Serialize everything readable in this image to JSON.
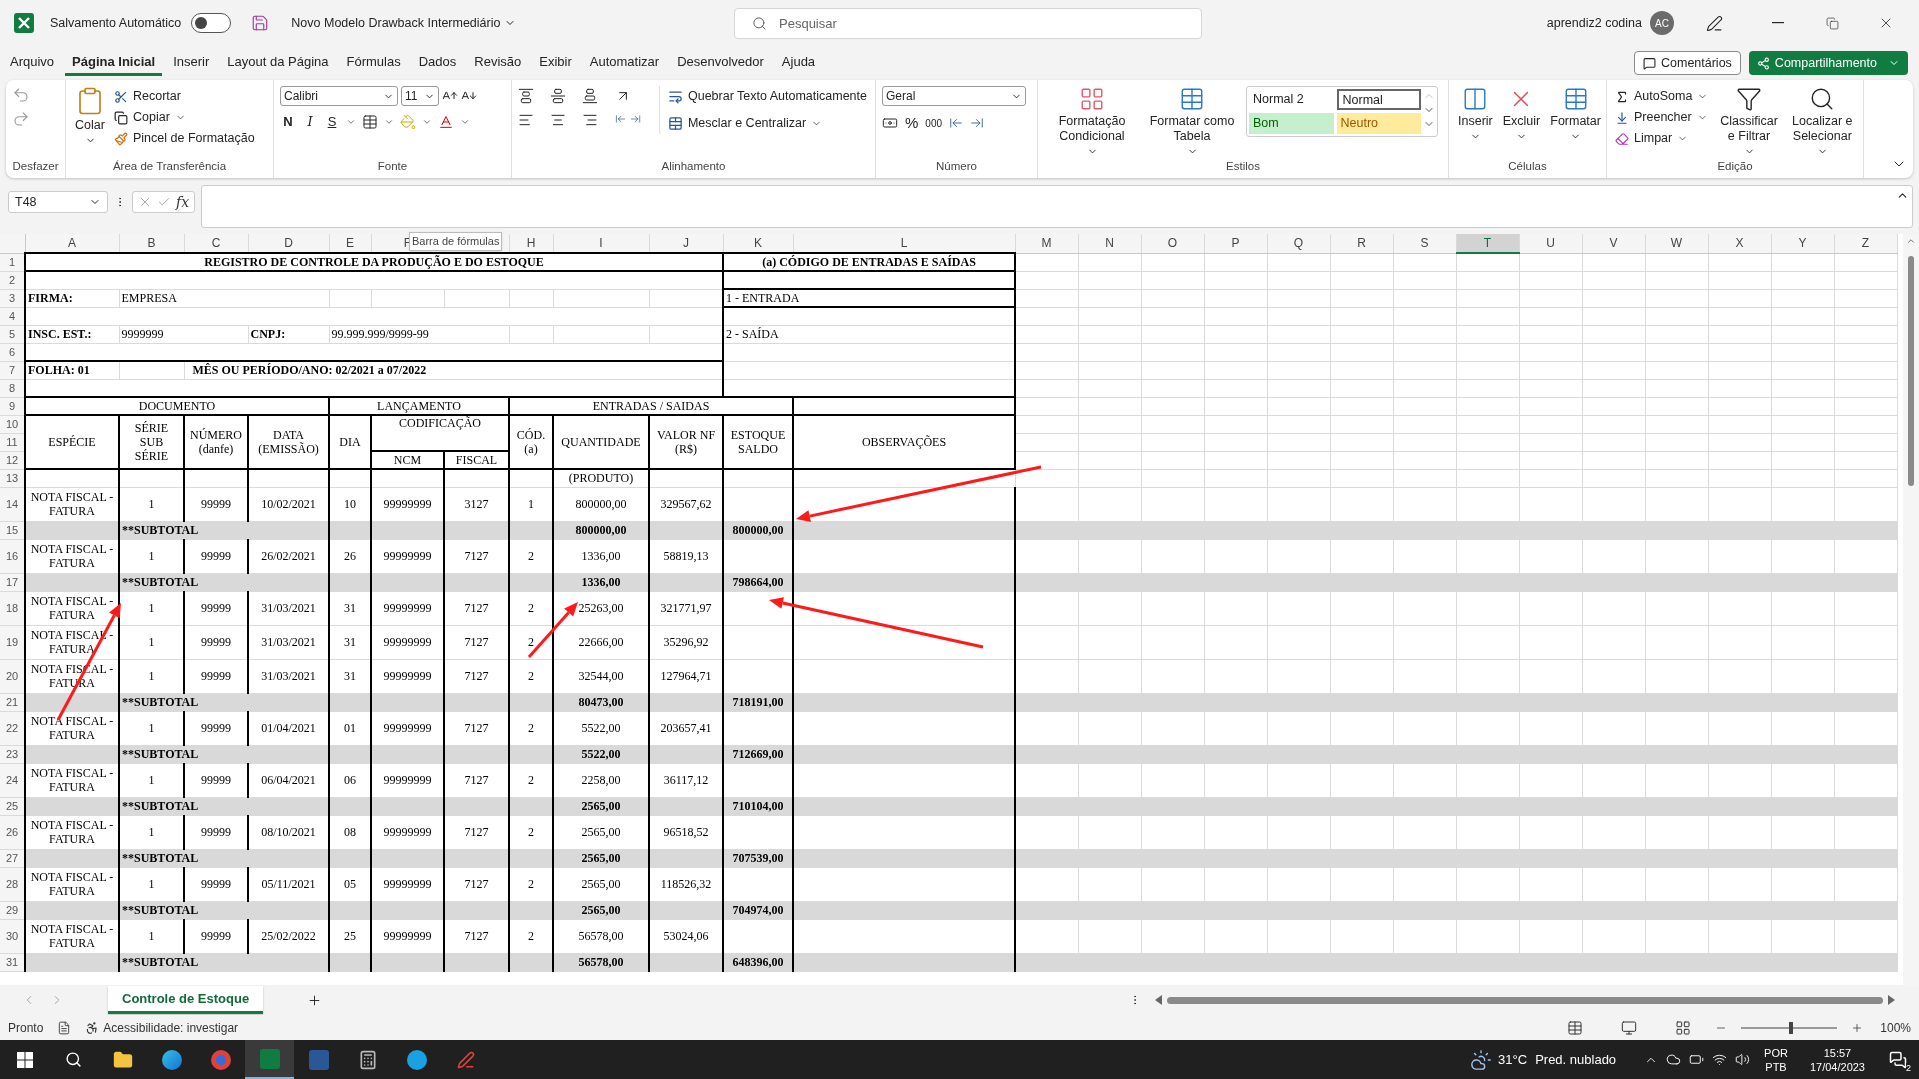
{
  "title_bar": {
    "autosave_label": "Salvamento Automático",
    "autosave_on": false,
    "file_name": "Novo Modelo Drawback Intermediário",
    "search_placeholder": "Pesquisar",
    "user_name": "aprendiz2 codina",
    "user_initials": "AC"
  },
  "menu_tabs": [
    {
      "label": "Arquivo",
      "selected": false
    },
    {
      "label": "Página Inicial",
      "selected": true
    },
    {
      "label": "Inserir",
      "selected": false
    },
    {
      "label": "Layout da Página",
      "selected": false
    },
    {
      "label": "Fórmulas",
      "selected": false
    },
    {
      "label": "Dados",
      "selected": false
    },
    {
      "label": "Revisão",
      "selected": false
    },
    {
      "label": "Exibir",
      "selected": false
    },
    {
      "label": "Automatizar",
      "selected": false
    },
    {
      "label": "Desenvolvedor",
      "selected": false
    },
    {
      "label": "Ajuda",
      "selected": false
    }
  ],
  "action_buttons": {
    "comments": "Comentários",
    "share": "Compartilhamento"
  },
  "ribbon": {
    "undo": {
      "label": "Desfazer"
    },
    "clipboard": {
      "label": "Área de Transferência",
      "paste": "Colar",
      "cut": "Recortar",
      "copy": "Copiar",
      "format_painter": "Pincel de Formatação"
    },
    "font": {
      "label": "Fonte",
      "family": "Calibri",
      "size": "11",
      "bold": "N",
      "italic": "I",
      "underline": "S"
    },
    "alignment": {
      "label": "Alinhamento",
      "wrap": "Quebrar Texto Automaticamente",
      "merge": "Mesclar e Centralizar"
    },
    "number": {
      "label": "Número",
      "format": "Geral",
      "percent": "%",
      "thousands": "000"
    },
    "styles": {
      "label": "Estilos",
      "conditional": "Formatação Condicional",
      "table": "Formatar como Tabela",
      "gallery": [
        {
          "label": "Normal 2",
          "kind": "plain"
        },
        {
          "label": "Normal",
          "kind": "outlined"
        },
        {
          "label": "Bom",
          "kind": "good"
        },
        {
          "label": "Neutro",
          "kind": "neutral"
        }
      ]
    },
    "cells": {
      "label": "Células",
      "insert": "Inserir",
      "delete": "Excluir",
      "format": "Formatar"
    },
    "editing": {
      "label": "Edição",
      "autosum": "AutoSoma",
      "fill": "Preencher",
      "clear": "Limpar",
      "sort": "Classificar e Filtrar",
      "find": "Localizar e Selecionar"
    }
  },
  "formula_bar": {
    "name_box": "T48",
    "function_symbol": "fx",
    "tooltip": "Barra de fórmulas"
  },
  "columns": [
    {
      "label": "A",
      "selected": false
    },
    {
      "label": "B",
      "selected": false
    },
    {
      "label": "C",
      "selected": false
    },
    {
      "label": "D",
      "selected": false
    },
    {
      "label": "E",
      "selected": false
    },
    {
      "label": "F",
      "selected": false
    },
    {
      "selected": false
    },
    {
      "label": "H",
      "selected": false
    },
    {
      "label": "I",
      "selected": false
    },
    {
      "label": "J",
      "selected": false
    },
    {
      "label": "K",
      "selected": false
    },
    {
      "label": "L",
      "selected": false
    },
    {
      "label": "M",
      "selected": false
    },
    {
      "label": "N",
      "selected": false
    },
    {
      "label": "O",
      "selected": false
    },
    {
      "label": "P",
      "selected": false
    },
    {
      "label": "Q",
      "selected": false
    },
    {
      "label": "R",
      "selected": false
    },
    {
      "label": "S",
      "selected": false
    },
    {
      "label": "T",
      "selected": true
    },
    {
      "label": "U",
      "selected": false
    },
    {
      "label": "V",
      "selected": false
    },
    {
      "label": "W",
      "selected": false
    },
    {
      "label": "X",
      "selected": false
    },
    {
      "label": "Y",
      "selected": false
    },
    {
      "label": "Z",
      "selected": false
    }
  ],
  "row_numbers": [
    "1",
    "2",
    "3",
    "4",
    "5",
    "6",
    "7",
    "8",
    "9",
    "10",
    "11",
    "12",
    "13",
    "14",
    "15",
    "16",
    "17",
    "18",
    "19",
    "20",
    "21",
    "22",
    "23",
    "24",
    "25",
    "26",
    "27",
    "28",
    "29",
    "30",
    "31"
  ],
  "sheet": {
    "title": "REGISTRO DE CONTROLE DA PRODUÇÃO E DO ESTOQUE",
    "codes_title": "(a) CÓDIGO DE ENTRADAS E SAÍDAS",
    "firm_label": "FIRMA:",
    "firm": "EMPRESA",
    "code_entry": "1 - ENTRADA",
    "state_reg_label": "INSC. EST.:",
    "state_reg": "9999999",
    "cnpj_label": "CNPJ:",
    "cnpj": "99.999.999/9999-99",
    "code_exit": "2 - SAÍDA",
    "sheet_number": "FOLHA: 01",
    "period": "MÊS OU PERÍODO/ANO: 02/2021 a 07/2022",
    "groups": {
      "document": "DOCUMENTO",
      "posting": "LANÇAMENTO",
      "flows": "ENTRADAS / SAIDAS"
    },
    "headers": {
      "species": "ESPÉCIE",
      "series": "SÉRIE SUB SÉRIE",
      "number": "NÚMERO (danfe)",
      "date": "DATA (EMISSÃO)",
      "day": "DIA",
      "coding": "CODIFICAÇÃO",
      "ncm": "NCM",
      "fiscal": "FISCAL",
      "code": "CÓD. (a)",
      "quantity": "QUANTIDADE",
      "invoice_value": "VALOR NF (R$)",
      "stock": "ESTOQUE SALDO",
      "notes": "OBSERVAÇÕES"
    },
    "product_note": "(PRODUTO)",
    "entries": [
      {
        "kind": "entry",
        "species": "NOTA FISCAL - FATURA",
        "series": "1",
        "number": "99999",
        "date": "10/02/2021",
        "day": "10",
        "ncm": "99999999",
        "fiscal": "3127",
        "code": "1",
        "quantity": "800000,00",
        "value": "329567,62"
      },
      {
        "kind": "subtotal",
        "label": "**SUBTOTAL",
        "quantity": "800000,00",
        "stock": "800000,00"
      },
      {
        "kind": "entry",
        "species": "NOTA FISCAL - FATURA",
        "series": "1",
        "number": "99999",
        "date": "26/02/2021",
        "day": "26",
        "ncm": "99999999",
        "fiscal": "7127",
        "code": "2",
        "quantity": "1336,00",
        "value": "58819,13"
      },
      {
        "kind": "subtotal",
        "label": "**SUBTOTAL",
        "quantity": "1336,00",
        "stock": "798664,00"
      },
      {
        "kind": "entry",
        "species": "NOTA FISCAL - FATURA",
        "series": "1",
        "number": "99999",
        "date": "31/03/2021",
        "day": "31",
        "ncm": "99999999",
        "fiscal": "7127",
        "code": "2",
        "quantity": "25263,00",
        "value": "321771,97"
      },
      {
        "kind": "entry",
        "species": "NOTA FISCAL - FATURA",
        "series": "1",
        "number": "99999",
        "date": "31/03/2021",
        "day": "31",
        "ncm": "99999999",
        "fiscal": "7127",
        "code": "2",
        "quantity": "22666,00",
        "value": "35296,92"
      },
      {
        "kind": "entry",
        "species": "NOTA FISCAL - FATURA",
        "series": "1",
        "number": "99999",
        "date": "31/03/2021",
        "day": "31",
        "ncm": "99999999",
        "fiscal": "7127",
        "code": "2",
        "quantity": "32544,00",
        "value": "127964,71"
      },
      {
        "kind": "subtotal",
        "label": "**SUBTOTAL",
        "quantity": "80473,00",
        "stock": "718191,00"
      },
      {
        "kind": "entry",
        "species": "NOTA FISCAL - FATURA",
        "series": "1",
        "number": "99999",
        "date": "01/04/2021",
        "day": "01",
        "ncm": "99999999",
        "fiscal": "7127",
        "code": "2",
        "quantity": "5522,00",
        "value": "203657,41"
      },
      {
        "kind": "subtotal",
        "label": "**SUBTOTAL",
        "quantity": "5522,00",
        "stock": "712669,00"
      },
      {
        "kind": "entry",
        "species": "NOTA FISCAL - FATURA",
        "series": "1",
        "number": "99999",
        "date": "06/04/2021",
        "day": "06",
        "ncm": "99999999",
        "fiscal": "7127",
        "code": "2",
        "quantity": "2258,00",
        "value": "36117,12"
      },
      {
        "kind": "subtotal",
        "label": "**SUBTOTAL",
        "quantity": "2565,00",
        "stock": "710104,00"
      },
      {
        "kind": "entry",
        "species": "NOTA FISCAL - FATURA",
        "series": "1",
        "number": "99999",
        "date": "08/10/2021",
        "day": "08",
        "ncm": "99999999",
        "fiscal": "7127",
        "code": "2",
        "quantity": "2565,00",
        "value": "96518,52"
      },
      {
        "kind": "subtotal",
        "label": "**SUBTOTAL",
        "quantity": "2565,00",
        "stock": "707539,00"
      },
      {
        "kind": "entry",
        "species": "NOTA FISCAL - FATURA",
        "series": "1",
        "number": "99999",
        "date": "05/11/2021",
        "day": "05",
        "ncm": "99999999",
        "fiscal": "7127",
        "code": "2",
        "quantity": "2565,00",
        "value": "118526,32"
      },
      {
        "kind": "subtotal",
        "label": "**SUBTOTAL",
        "quantity": "2565,00",
        "stock": "704974,00"
      },
      {
        "kind": "entry",
        "species": "NOTA FISCAL - FATURA",
        "series": "1",
        "number": "99999",
        "date": "25/02/2022",
        "day": "25",
        "ncm": "99999999",
        "fiscal": "7127",
        "code": "2",
        "quantity": "56578,00",
        "value": "53024,06"
      },
      {
        "kind": "subtotal",
        "label": "**SUBTOTAL",
        "quantity": "56578,00",
        "stock": "648396,00"
      }
    ]
  },
  "sheet_tabs": [
    {
      "label": "Controle de Estoque",
      "selected": true
    }
  ],
  "status_bar": {
    "ready": "Pronto",
    "accessibility": "Acessibilidade: investigar",
    "zoom": "100%",
    "zoom_slider": {
      "level": 0.5
    }
  },
  "taskbar": {
    "temperature": "31°C",
    "weather": "Pred. nublado",
    "language": "POR",
    "layout": "PTB",
    "time": "15:57",
    "date": "17/04/2023",
    "notifications": "2"
  }
}
